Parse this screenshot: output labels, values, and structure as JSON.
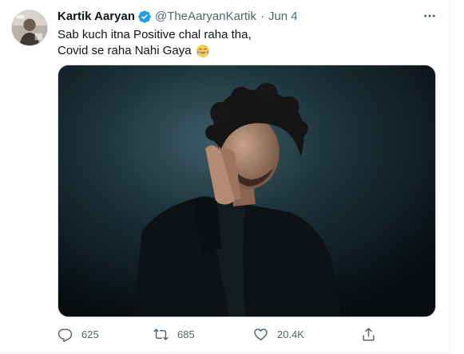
{
  "tweet": {
    "author_name": "Kartik Aaryan",
    "handle": "@TheAaryanKartik",
    "separator": "·",
    "date": "Jun 4",
    "text_line1": "Sab kuch itna Positive chal raha tha,",
    "text_line2": "Covid se raha Nahi Gaya",
    "emoji": "face-with-tears-of-joy"
  },
  "icons": {
    "verified": "verified-badge-icon",
    "more": "more-options-icon",
    "reply": "reply-icon",
    "retweet": "retweet-icon",
    "like": "like-icon",
    "share": "share-icon"
  },
  "actions": {
    "reply_count": "625",
    "retweet_count": "685",
    "like_count": "20.4K"
  },
  "colors": {
    "primary_text": "#0f1419",
    "secondary_text": "#536471",
    "verified_blue": "#1d9bf0",
    "border": "#cfd9de"
  }
}
